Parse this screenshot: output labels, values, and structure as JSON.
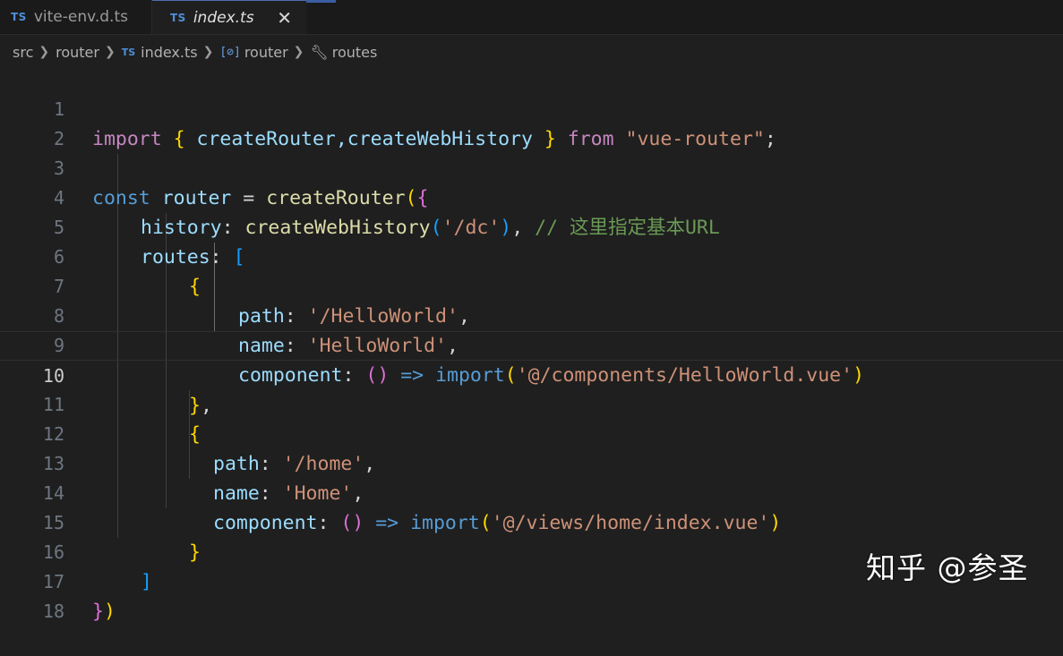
{
  "tabs": [
    {
      "badge": "TS",
      "label": "vite-env.d.ts"
    },
    {
      "badge": "TS",
      "label": "index.ts",
      "close": "✕"
    }
  ],
  "breadcrumb": {
    "parts": [
      "src",
      "router"
    ],
    "file_badge": "TS",
    "file": "index.ts",
    "symbol_icon": "[⊘]",
    "symbol": "router",
    "prop_icon": "wrench-icon",
    "prop": "routes"
  },
  "line_numbers": [
    "1",
    "2",
    "3",
    "4",
    "5",
    "6",
    "7",
    "8",
    "9",
    "10",
    "11",
    "12",
    "13",
    "14",
    "15",
    "16",
    "17",
    "18"
  ],
  "code": {
    "l1": {
      "kw": "import",
      "ob": "{",
      "names": " createRouter,createWebHistory ",
      "cb": "}",
      "from": "from",
      "str": "\"vue-router\"",
      "end": ";"
    },
    "l3": {
      "kw": "const",
      "name": "router",
      "eq": " = ",
      "fn": "createRouter",
      "p": "(",
      "b": "{"
    },
    "l4": {
      "key": "history",
      "colon": ": ",
      "fn": "createWebHistory",
      "p": "(",
      "str": "'/dc'",
      "p2": ")",
      "comma": ", ",
      "cmt": "// 这里指定基本URL"
    },
    "l5": {
      "key": "routes",
      "colon": ": ",
      "b": "["
    },
    "l6": {
      "b": "{"
    },
    "l7": {
      "key": "path",
      "colon": ": ",
      "str": "'/HelloWorld'",
      "comma": ","
    },
    "l8": {
      "key": "name",
      "colon": ": ",
      "str": "'HelloWorld'",
      "comma": ","
    },
    "l9": {
      "key": "component",
      "colon": ": ",
      "pp": "()",
      "arrow": " => ",
      "imp": "import",
      "p": "(",
      "str": "'@/components/HelloWorld.vue'",
      "p2": ")"
    },
    "l10": {
      "b": "}",
      "comma": ","
    },
    "l11": {
      "b": "{"
    },
    "l12": {
      "key": "path",
      "colon": ": ",
      "str": "'/home'",
      "comma": ","
    },
    "l13": {
      "key": "name",
      "colon": ": ",
      "str": "'Home'",
      "comma": ","
    },
    "l14": {
      "key": "component",
      "colon": ": ",
      "pp": "()",
      "arrow": " => ",
      "imp": "import",
      "p": "(",
      "str": "'@/views/home/index.vue'",
      "p2": ")"
    },
    "l15": {
      "b": "}"
    },
    "l16": {
      "b": "]"
    },
    "l17": {
      "b": "}",
      "p": ")"
    }
  },
  "watermark": "知乎 @参圣",
  "colors": {
    "keyword": "#569cd6",
    "string": "#ce9178",
    "function": "#dcdcaa",
    "property": "#9cdcfe",
    "comment": "#6a9955",
    "bracket_gold": "#ffd700",
    "bracket_pink": "#da70d6",
    "bracket_blue": "#179fff"
  }
}
